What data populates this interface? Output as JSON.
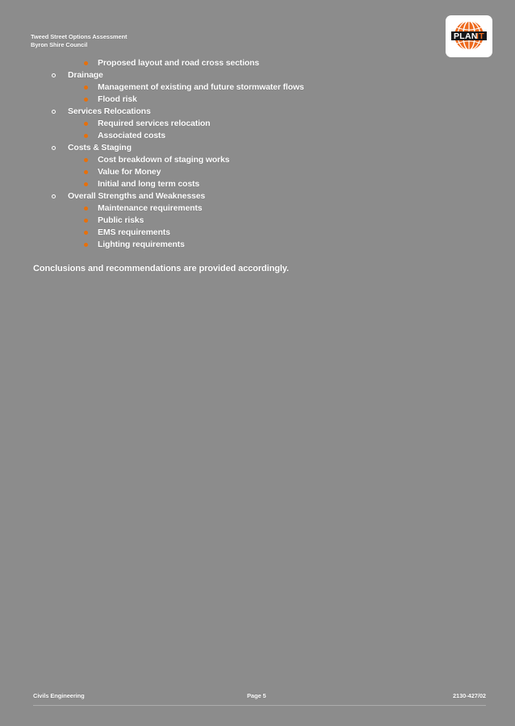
{
  "document": {
    "header": {
      "line1": "Tweed Street Options Assessment",
      "line2": "Byron Shire Council"
    },
    "logo": {
      "name": "planit-logo",
      "wordmark": "PLANIT",
      "globe_color": "#ee6a1e",
      "accent_color": "#ee6a1e",
      "text_color": "#1a1a1a",
      "background_color": "#ffffff"
    },
    "outline": [
      {
        "level": 2,
        "text": "Proposed layout and road cross sections"
      },
      {
        "level": 1,
        "text": "Drainage"
      },
      {
        "level": 2,
        "text": "Management of existing and future stormwater flows"
      },
      {
        "level": 2,
        "text": "Flood risk"
      },
      {
        "level": 1,
        "text": "Services Relocations"
      },
      {
        "level": 2,
        "text": "Required services relocation"
      },
      {
        "level": 2,
        "text": "Associated costs"
      },
      {
        "level": 1,
        "text": "Costs & Staging"
      },
      {
        "level": 2,
        "text": "Cost breakdown of staging works"
      },
      {
        "level": 2,
        "text": "Value for Money"
      },
      {
        "level": 2,
        "text": "Initial and long term costs"
      },
      {
        "level": 1,
        "text": "Overall Strengths and Weaknesses"
      },
      {
        "level": 2,
        "text": "Maintenance requirements"
      },
      {
        "level": 2,
        "text": "Public risks"
      },
      {
        "level": 2,
        "text": "EMS requirements"
      },
      {
        "level": 2,
        "text": "Lighting requirements"
      }
    ],
    "paragraph": "Conclusions and recommendations are provided accordingly.",
    "footer": {
      "left": "Civils Engineering",
      "center": "Page 5",
      "right": "2130-427/02"
    },
    "colors": {
      "page_background": "#8c8c8c",
      "text": "#ffffff",
      "bullet_accent": "#e8700a"
    }
  }
}
